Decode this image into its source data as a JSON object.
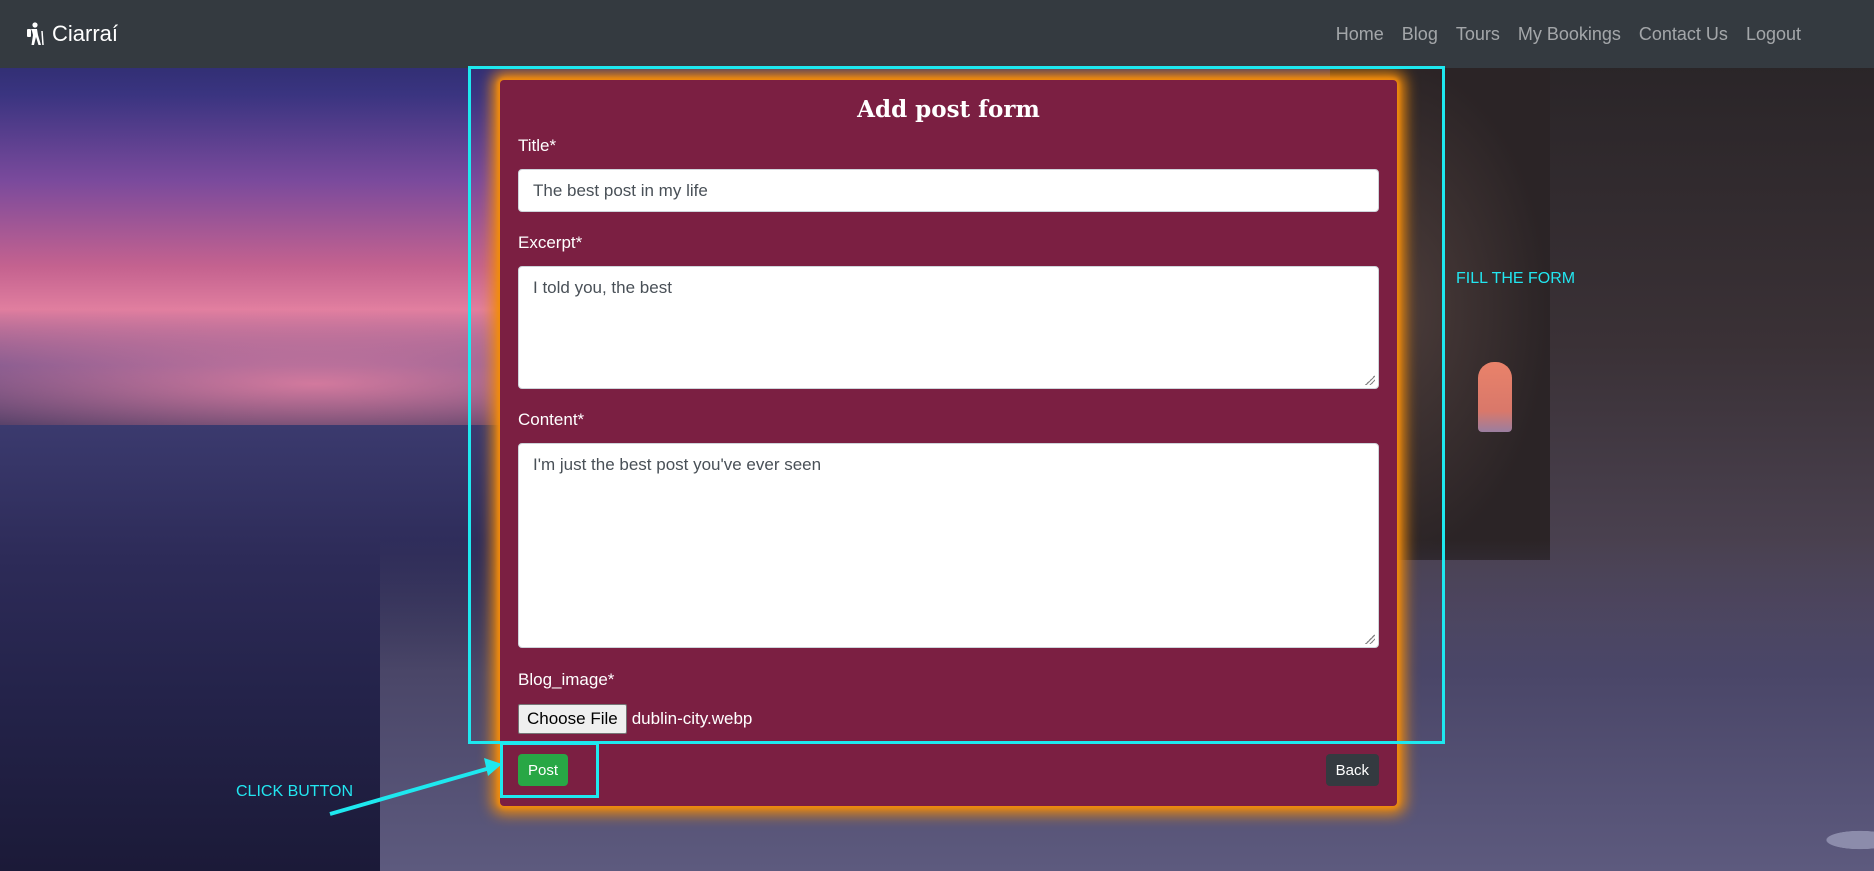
{
  "navbar": {
    "brand": "Ciarraí",
    "brand_icon": "hiker-icon",
    "links": [
      "Home",
      "Blog",
      "Tours",
      "My Bookings",
      "Contact Us",
      "Logout"
    ]
  },
  "form": {
    "title": "Add post form",
    "title_label": "Title*",
    "title_value": "The best post in my life",
    "excerpt_label": "Excerpt*",
    "excerpt_value": "I told you, the best",
    "content_label": "Content*",
    "content_value": "I'm just the best post you've ever seen",
    "image_label": "Blog_image*",
    "choose_file_label": "Choose File",
    "file_name": "dublin-city.webp",
    "post_label": "Post",
    "back_label": "Back"
  },
  "annotations": {
    "fill_form": "FILL THE FORM",
    "click_button": "CLICK BUTTON",
    "highlight_color": "#1ee8ef"
  },
  "colors": {
    "navbar_bg": "#343a40",
    "card_bg": "#7b1f42",
    "card_glow": "#f08a0a",
    "post_button": "#28a745",
    "back_button": "#343a40"
  }
}
